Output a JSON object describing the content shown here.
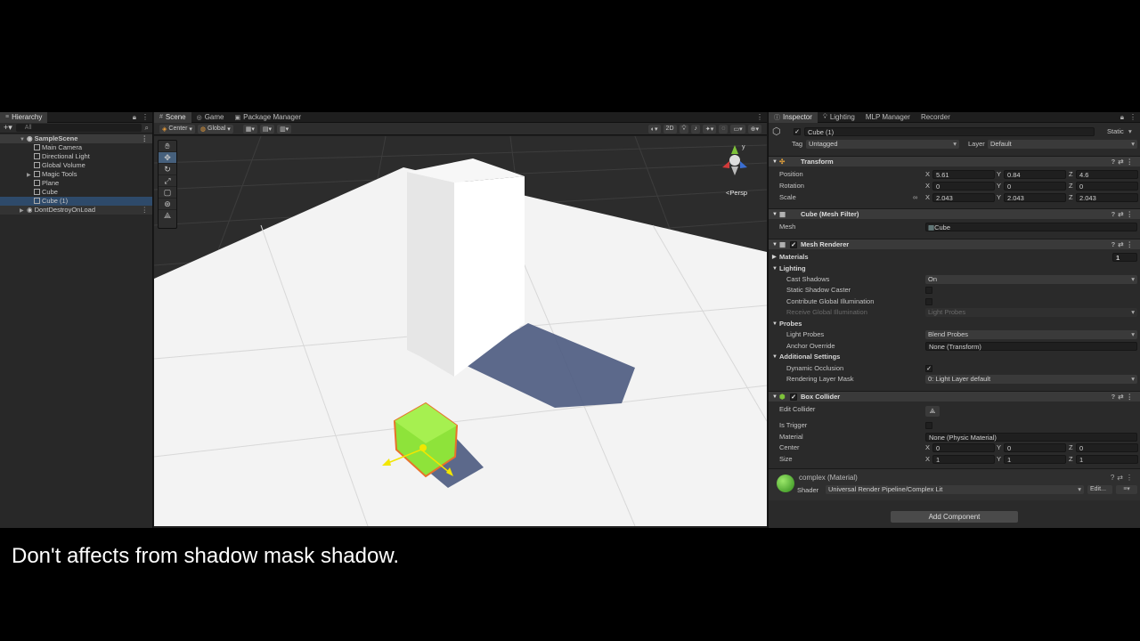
{
  "hierarchy": {
    "tab_label": "Hierarchy",
    "search_placeholder": "All",
    "items": [
      {
        "label": "SampleScene"
      },
      {
        "label": "Main Camera"
      },
      {
        "label": "Directional Light"
      },
      {
        "label": "Global Volume"
      },
      {
        "label": "Magic Tools"
      },
      {
        "label": "Plane"
      },
      {
        "label": "Cube"
      },
      {
        "label": "Cube (1)"
      },
      {
        "label": "DontDestroyOnLoad"
      }
    ]
  },
  "scene": {
    "tabs": [
      "Scene",
      "Game",
      "Package Manager"
    ],
    "pivot_label": "Center",
    "space_label": "Global",
    "mode_2d": "2D",
    "persp_label": "<Persp"
  },
  "inspector": {
    "tabs": [
      "Inspector",
      "Lighting",
      "MLP Manager",
      "Recorder"
    ],
    "object_name": "Cube (1)",
    "static_label": "Static",
    "tag_label": "Tag",
    "tag_value": "Untagged",
    "layer_label": "Layer",
    "layer_value": "Default",
    "transform": {
      "title": "Transform",
      "position_label": "Position",
      "rotation_label": "Rotation",
      "scale_label": "Scale",
      "position": {
        "x": "5.61",
        "y": "0.84",
        "z": "4.6"
      },
      "rotation": {
        "x": "0",
        "y": "0",
        "z": "0"
      },
      "scale": {
        "x": "2.043",
        "y": "2.043",
        "z": "2.043"
      }
    },
    "mesh_filter": {
      "title": "Cube (Mesh Filter)",
      "mesh_label": "Mesh",
      "mesh_value": "Cube"
    },
    "mesh_renderer": {
      "title": "Mesh Renderer",
      "materials_label": "Materials",
      "materials_count": "1",
      "lighting_label": "Lighting",
      "cast_shadows_label": "Cast Shadows",
      "cast_shadows_value": "On",
      "static_shadow_label": "Static Shadow Caster",
      "contribute_gi_label": "Contribute Global Illumination",
      "receive_gi_label": "Receive Global Illumination",
      "receive_gi_value": "Light Probes",
      "probes_label": "Probes",
      "light_probes_label": "Light Probes",
      "light_probes_value": "Blend Probes",
      "anchor_label": "Anchor Override",
      "anchor_value": "None (Transform)",
      "additional_label": "Additional Settings",
      "dynamic_occlusion_label": "Dynamic Occlusion",
      "rendering_layer_label": "Rendering Layer Mask",
      "rendering_layer_value": "0: Light Layer default"
    },
    "box_collider": {
      "title": "Box Collider",
      "edit_label": "Edit Collider",
      "trigger_label": "Is Trigger",
      "material_label": "Material",
      "material_value": "None (Physic Material)",
      "center_label": "Center",
      "size_label": "Size",
      "center": {
        "x": "0",
        "y": "0",
        "z": "0"
      },
      "size": {
        "x": "1",
        "y": "1",
        "z": "1"
      }
    },
    "material": {
      "name": "complex (Material)",
      "shader_label": "Shader",
      "shader_value": "Universal Render Pipeline/Complex Lit",
      "edit_label": "Edit..."
    },
    "add_component": "Add Component"
  },
  "caption": "Don't affects from shadow mask shadow.",
  "colors": {
    "selected_cube": "#8ee33a",
    "selection_outline": "#e8722a",
    "ground": "#f2f2f2"
  }
}
